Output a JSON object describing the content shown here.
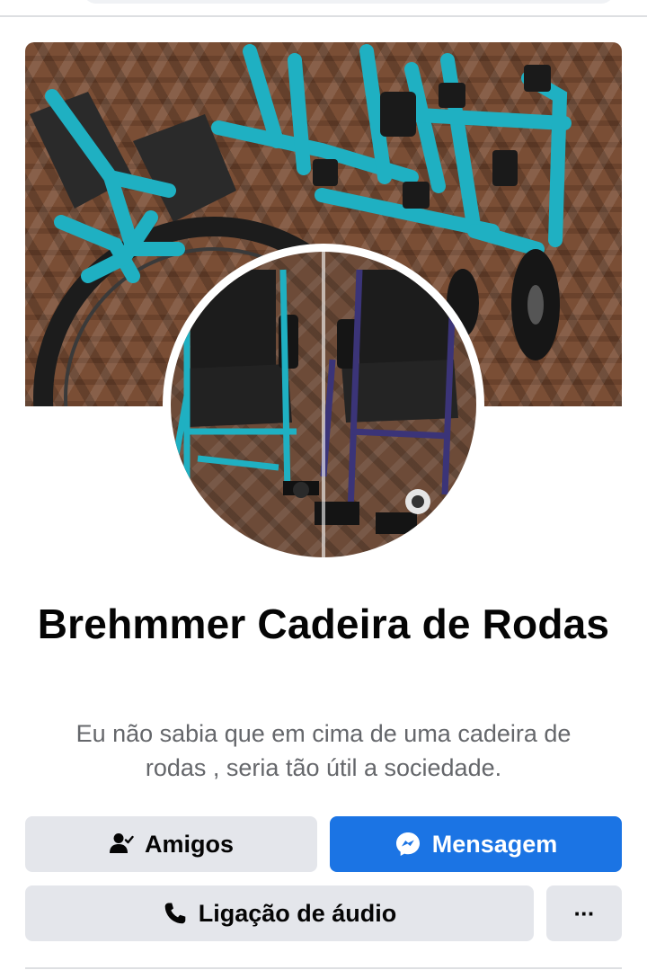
{
  "profile": {
    "name": "Brehmmer Cadeira de Rodas",
    "bio": "Eu não sabia que em cima de uma cadeira de rodas , seria tão útil a sociedade."
  },
  "actions": {
    "friends_label": "Amigos",
    "message_label": "Mensagem",
    "call_label": "Ligação de áudio",
    "more_label": "···"
  },
  "icons": {
    "friends": "person-check-icon",
    "message": "messenger-icon",
    "call": "phone-icon",
    "more": "more-dots-icon"
  },
  "colors": {
    "primary": "#1b74e4",
    "button_gray": "#e4e6eb",
    "text_primary": "#050505",
    "text_secondary": "#65676b",
    "wheelchair_teal": "#1fb0c2"
  }
}
